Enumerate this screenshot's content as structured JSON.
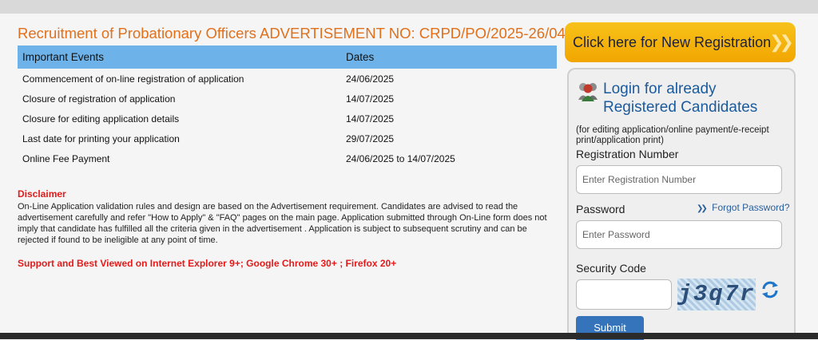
{
  "main": {
    "title": "Recruitment of Probationary Officers ADVERTISEMENT NO: CRPD/PO/2025-26/04",
    "table": {
      "headers": [
        "Important Events",
        "Dates"
      ],
      "rows": [
        [
          "Commencement of on-line registration of application",
          "24/06/2025"
        ],
        [
          "Closure of registration of application",
          "14/07/2025"
        ],
        [
          "Closure for editing application details",
          "14/07/2025"
        ],
        [
          "Last date for printing your application",
          "29/07/2025"
        ],
        [
          "Online Fee Payment",
          "24/06/2025 to 14/07/2025"
        ]
      ]
    },
    "disclaimer": {
      "title": "Disclaimer",
      "body": "On-Line Application validation rules and design are based on the Advertisement requirement. Candidates are advised to read the advertisement carefully and refer \"How to Apply\" & \"FAQ\" pages on the main page. Application submitted through On-Line form does not imply that candidate has fulfilled all the criteria given in the advertisement . Application is subject to subsequent scrutiny and can be rejected if found to be ineligible at any point of time."
    },
    "support": "Support and Best Viewed on Internet Explorer 9+; Google Chrome 30+ ; Firefox 20+"
  },
  "sidebar": {
    "registration_button": "Click here for New Registration",
    "login": {
      "title_line1": "Login for already",
      "title_line2": "Registered Candidates",
      "note": "(for editing application/online payment/e-receipt print/application print)",
      "registration_label": "Registration Number",
      "registration_placeholder": "Enter Registration Number",
      "password_label": "Password",
      "password_placeholder": "Enter Password",
      "forgot_password": "Forgot Password?",
      "security_label": "Security Code",
      "captcha_text": "j3q7r",
      "submit_label": "Submit"
    }
  },
  "colors": {
    "title": "#e0701c",
    "table_header": "#6db3ea",
    "alert": "#e31a1a",
    "registration_button": "#f2a600",
    "link": "#2a5e9b",
    "submit": "#3574ba"
  },
  "icons": [
    "users-icon",
    "double-chevron-right-icon",
    "refresh-icon"
  ]
}
